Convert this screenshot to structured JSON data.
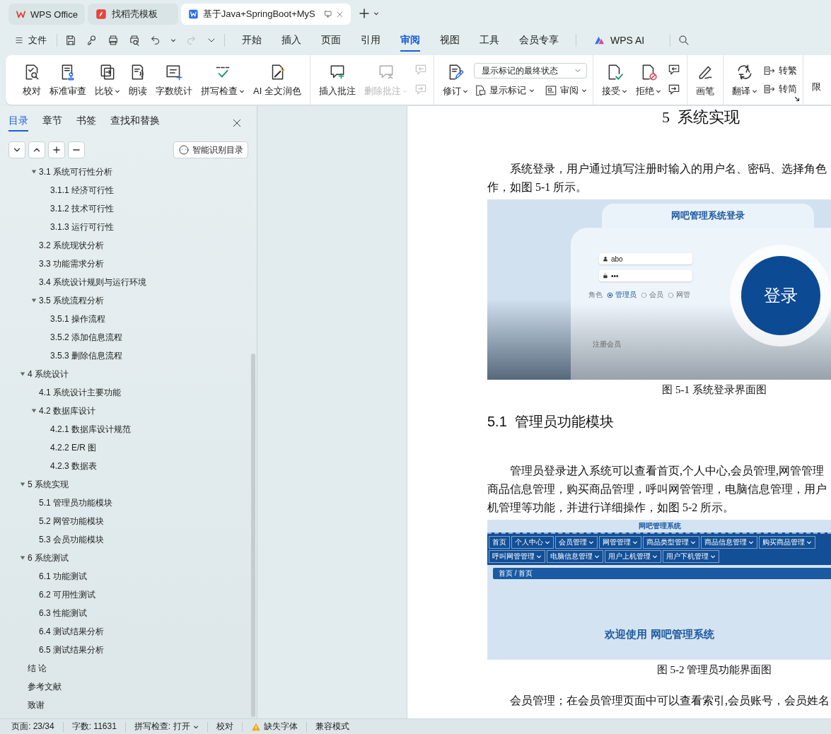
{
  "title_tabs": [
    {
      "label": "WPS Office",
      "selected": false
    },
    {
      "label": "找稻壳模板",
      "selected": false
    },
    {
      "label": "基于Java+SpringBoot+MyS",
      "selected": true
    }
  ],
  "menu_bar": {
    "file_menu": "文件",
    "tabs": [
      {
        "label": "开始",
        "selected": false
      },
      {
        "label": "插入",
        "selected": false
      },
      {
        "label": "页面",
        "selected": false
      },
      {
        "label": "引用",
        "selected": false
      },
      {
        "label": "审阅",
        "selected": true
      },
      {
        "label": "视图",
        "selected": false
      },
      {
        "label": "工具",
        "selected": false
      },
      {
        "label": "会员专享",
        "selected": false
      }
    ],
    "ai_button": "WPS AI"
  },
  "ribbon": {
    "groups": [
      {
        "has_launcher": false,
        "items": [
          {
            "kind": "large",
            "label": "校对",
            "has_menu": false,
            "disabled": false
          },
          {
            "kind": "large",
            "label": "标准审查",
            "has_menu": false,
            "disabled": false
          },
          {
            "kind": "large",
            "label": "比较",
            "has_menu": true,
            "disabled": false
          },
          {
            "kind": "large",
            "label": "朗读",
            "has_menu": false,
            "disabled": false
          },
          {
            "kind": "large",
            "label": "字数统计",
            "has_menu": false,
            "disabled": false
          },
          {
            "kind": "large",
            "label": "拼写检查",
            "has_menu": true,
            "disabled": false
          },
          {
            "kind": "large",
            "label": "AI 全文润色",
            "has_menu": false,
            "disabled": false
          }
        ]
      },
      {
        "has_launcher": false,
        "items": [
          {
            "kind": "large",
            "label": "插入批注",
            "has_menu": false,
            "disabled": false
          },
          {
            "kind": "large",
            "label": "删除批注",
            "has_menu": true,
            "disabled": true
          },
          {
            "kind": "icon",
            "disabled": true
          },
          {
            "kind": "icon",
            "disabled": true
          }
        ]
      },
      {
        "has_launcher": false,
        "items": [
          {
            "kind": "large",
            "label": "修订",
            "has_menu": true,
            "disabled": false
          },
          {
            "kind": "select",
            "value": "显示标记的最终状态",
            "disabled": false
          },
          {
            "kind": "small",
            "label": "显示标记",
            "has_menu": true,
            "disabled": false
          },
          {
            "kind": "small",
            "label": "审阅",
            "has_menu": true,
            "disabled": false
          }
        ]
      },
      {
        "has_launcher": false,
        "items": [
          {
            "kind": "large",
            "label": "接受",
            "has_menu": true,
            "disabled": false
          },
          {
            "kind": "large",
            "label": "拒绝",
            "has_menu": true,
            "disabled": false
          },
          {
            "kind": "icon",
            "disabled": false
          },
          {
            "kind": "icon",
            "disabled": false
          }
        ]
      },
      {
        "has_launcher": false,
        "items": [
          {
            "kind": "large",
            "label": "画笔",
            "has_menu": false,
            "disabled": false
          }
        ]
      },
      {
        "has_launcher": true,
        "items": [
          {
            "kind": "large",
            "label": "翻译",
            "has_menu": true,
            "disabled": false
          },
          {
            "kind": "small",
            "label": "转繁",
            "has_menu": false,
            "disabled": false
          },
          {
            "kind": "small",
            "label": "转简",
            "has_menu": false,
            "disabled": false
          }
        ]
      }
    ],
    "overflow_label": "限"
  },
  "sidebar": {
    "tabs": [
      {
        "label": "目录",
        "selected": true
      },
      {
        "label": "章节",
        "selected": false
      },
      {
        "label": "书签",
        "selected": false
      },
      {
        "label": "查找和替换",
        "selected": false
      }
    ],
    "smart_toc_button": "智能识别目录",
    "toc": {
      "continued_children": [
        {
          "label": "3.1  系统可行性分析",
          "expanded": true,
          "children": [
            {
              "label": "3.1.1  经济可行性"
            },
            {
              "label": "3.1.2  技术可行性"
            },
            {
              "label": "3.1.3  运行可行性"
            }
          ]
        },
        {
          "label": "3.2  系统现状分析"
        },
        {
          "label": "3.3  功能需求分析"
        },
        {
          "label": "3.4  系统设计规则与运行环境"
        },
        {
          "label": "3.5 系统流程分析",
          "expanded": true,
          "children": [
            {
              "label": "3.5.1 操作流程"
            },
            {
              "label": "3.5.2 添加信息流程"
            },
            {
              "label": "3.5.3 删除信息流程"
            }
          ]
        }
      ],
      "items": [
        {
          "label": "4  系统设计",
          "expanded": true,
          "children": [
            {
              "label": "4.1  系统设计主要功能"
            },
            {
              "label": "4.2  数据库设计",
              "expanded": true,
              "children": [
                {
                  "label": "4.2.1  数据库设计规范"
                },
                {
                  "label": "4.2.2 E/R 图"
                },
                {
                  "label": "4.2.3  数据表"
                }
              ]
            }
          ]
        },
        {
          "label": "5  系统实现",
          "expanded": true,
          "children": [
            {
              "label": "5.1  管理员功能模块"
            },
            {
              "label": "5.2  网管功能模块"
            },
            {
              "label": "5.3  会员功能模块"
            }
          ]
        },
        {
          "label": "6  系统测试",
          "expanded": true,
          "children": [
            {
              "label": "6.1  功能测试"
            },
            {
              "label": "6.2  可用性测试"
            },
            {
              "label": "6.3  性能测试"
            },
            {
              "label": "6.4  测试结果分析"
            },
            {
              "label": "6.5  测试结果分析"
            }
          ]
        },
        {
          "label": "结  论"
        },
        {
          "label": "参考文献"
        },
        {
          "label": "致谢"
        }
      ]
    }
  },
  "document": {
    "blocks": [
      {
        "kind": "heading1",
        "text": "5  系统实现"
      },
      {
        "kind": "paragraph",
        "lines": [
          "系统登录，用户通过填写注册时输入的用户名、密码、选择角色",
          "作，如图 5-1 所示。"
        ]
      },
      {
        "kind": "figure",
        "screen": {
          "kind": "login",
          "title": "网吧管理系统登录",
          "username": "abo",
          "password": "•••",
          "role_label": "角色",
          "roles": [
            {
              "label": "管理员",
              "selected": true
            },
            {
              "label": "会员",
              "selected": false
            },
            {
              "label": "网管",
              "selected": false
            }
          ],
          "login_button": "登录",
          "register_link": "注册会员"
        }
      },
      {
        "kind": "caption",
        "text": "图 5-1 系统登录界面图"
      },
      {
        "kind": "heading2",
        "text": "5.1  管理员功能模块"
      },
      {
        "kind": "paragraph",
        "lines": [
          "管理员登录进入系统可以查看首页,个人中心,会员管理,网管管理",
          "商品信息管理，购买商品管理，呼叫网管管理，电脑信息管理，用户",
          "机管理等功能，并进行详细操作，如图 5-2 所示。"
        ]
      },
      {
        "kind": "figure",
        "screen": {
          "kind": "admin",
          "title": "网吧管理系统",
          "nav": [
            {
              "label": "首页",
              "has_menu": false
            },
            {
              "label": "个人中心",
              "has_menu": true
            },
            {
              "label": "会员管理",
              "has_menu": true
            },
            {
              "label": "网管管理",
              "has_menu": true
            },
            {
              "label": "商品类型管理",
              "has_menu": true
            },
            {
              "label": "商品信息管理",
              "has_menu": true
            },
            {
              "label": "购买商品管理",
              "has_menu": true
            },
            {
              "label": "呼叫网管管理",
              "has_menu": true
            },
            {
              "label": "电脑信息管理",
              "has_menu": true
            },
            {
              "label": "用户上机管理",
              "has_menu": true
            },
            {
              "label": "用户下机管理",
              "has_menu": true
            }
          ],
          "breadcrumb": "首页 / 首页",
          "welcome": "欢迎使用 网吧管理系统"
        }
      },
      {
        "kind": "caption",
        "text": "图 5-2 管理员功能界面图"
      },
      {
        "kind": "paragraph",
        "lines": [
          "会员管理；在会员管理页面中可以查看索引,会员账号，会员姓名"
        ]
      }
    ]
  },
  "status_bar": {
    "page": "页面: 23/34",
    "word_count": "字数: 11631",
    "spell_check": "拼写检查: 打开",
    "proofread": "校对",
    "missing_fonts": "缺失字体",
    "compat_mode": "兼容模式"
  }
}
